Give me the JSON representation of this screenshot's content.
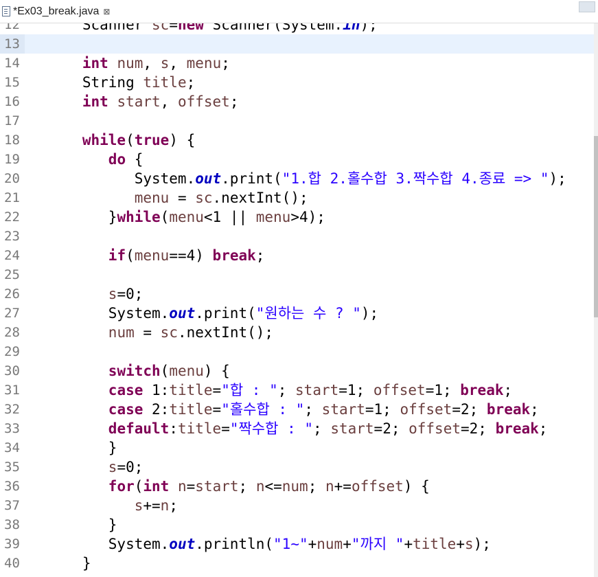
{
  "tab": {
    "title": "*Ex03_break.java",
    "close_symbol": "⊠"
  },
  "colors": {
    "keyword": "#7f0055",
    "string": "#2a00ff",
    "field": "#0000c0",
    "local_var": "#6a3e3e",
    "current_line": "#e8f2fe"
  },
  "editor": {
    "current_line": "13",
    "lines": [
      {
        "n": "12",
        "tokens": [
          [
            "p",
            "      Scanner "
          ],
          [
            "v",
            "sc"
          ],
          [
            "p",
            "="
          ],
          [
            "k",
            "new"
          ],
          [
            "p",
            " Scanner(System."
          ],
          [
            "f",
            "in"
          ],
          [
            "p",
            ");"
          ]
        ]
      },
      {
        "n": "13",
        "tokens": []
      },
      {
        "n": "14",
        "tokens": [
          [
            "p",
            "      "
          ],
          [
            "k",
            "int"
          ],
          [
            "p",
            " "
          ],
          [
            "v",
            "num"
          ],
          [
            "p",
            ", "
          ],
          [
            "v",
            "s"
          ],
          [
            "p",
            ", "
          ],
          [
            "v",
            "menu"
          ],
          [
            "p",
            ";"
          ]
        ]
      },
      {
        "n": "15",
        "tokens": [
          [
            "p",
            "      String "
          ],
          [
            "v",
            "title"
          ],
          [
            "p",
            ";"
          ]
        ]
      },
      {
        "n": "16",
        "tokens": [
          [
            "p",
            "      "
          ],
          [
            "k",
            "int"
          ],
          [
            "p",
            " "
          ],
          [
            "v",
            "start"
          ],
          [
            "p",
            ", "
          ],
          [
            "v",
            "offset"
          ],
          [
            "p",
            ";"
          ]
        ]
      },
      {
        "n": "17",
        "tokens": []
      },
      {
        "n": "18",
        "tokens": [
          [
            "p",
            "      "
          ],
          [
            "k",
            "while"
          ],
          [
            "p",
            "("
          ],
          [
            "k",
            "true"
          ],
          [
            "p",
            ") {"
          ]
        ]
      },
      {
        "n": "19",
        "tokens": [
          [
            "p",
            "         "
          ],
          [
            "k",
            "do"
          ],
          [
            "p",
            " {"
          ]
        ]
      },
      {
        "n": "20",
        "tokens": [
          [
            "p",
            "            System."
          ],
          [
            "f",
            "out"
          ],
          [
            "p",
            ".print("
          ],
          [
            "s",
            "\"1.합 2.홀수합 3.짝수합 4.종료 => \""
          ],
          [
            "p",
            ");"
          ]
        ]
      },
      {
        "n": "21",
        "tokens": [
          [
            "p",
            "            "
          ],
          [
            "v",
            "menu"
          ],
          [
            "p",
            " = "
          ],
          [
            "v",
            "sc"
          ],
          [
            "p",
            ".nextInt();"
          ]
        ]
      },
      {
        "n": "22",
        "tokens": [
          [
            "p",
            "         }"
          ],
          [
            "k",
            "while"
          ],
          [
            "p",
            "("
          ],
          [
            "v",
            "menu"
          ],
          [
            "p",
            "<1 || "
          ],
          [
            "v",
            "menu"
          ],
          [
            "p",
            ">4);"
          ]
        ]
      },
      {
        "n": "23",
        "tokens": []
      },
      {
        "n": "24",
        "tokens": [
          [
            "p",
            "         "
          ],
          [
            "k",
            "if"
          ],
          [
            "p",
            "("
          ],
          [
            "v",
            "menu"
          ],
          [
            "p",
            "==4) "
          ],
          [
            "k",
            "break"
          ],
          [
            "p",
            ";"
          ]
        ]
      },
      {
        "n": "25",
        "tokens": []
      },
      {
        "n": "26",
        "tokens": [
          [
            "p",
            "         "
          ],
          [
            "v",
            "s"
          ],
          [
            "p",
            "=0;"
          ]
        ]
      },
      {
        "n": "27",
        "tokens": [
          [
            "p",
            "         System."
          ],
          [
            "f",
            "out"
          ],
          [
            "p",
            ".print("
          ],
          [
            "s",
            "\"원하는 수 ? \""
          ],
          [
            "p",
            ");"
          ]
        ]
      },
      {
        "n": "28",
        "tokens": [
          [
            "p",
            "         "
          ],
          [
            "v",
            "num"
          ],
          [
            "p",
            " = "
          ],
          [
            "v",
            "sc"
          ],
          [
            "p",
            ".nextInt();"
          ]
        ]
      },
      {
        "n": "29",
        "tokens": []
      },
      {
        "n": "30",
        "tokens": [
          [
            "p",
            "         "
          ],
          [
            "k",
            "switch"
          ],
          [
            "p",
            "("
          ],
          [
            "v",
            "menu"
          ],
          [
            "p",
            ") {"
          ]
        ]
      },
      {
        "n": "31",
        "tokens": [
          [
            "p",
            "         "
          ],
          [
            "k",
            "case"
          ],
          [
            "p",
            " 1:"
          ],
          [
            "v",
            "title"
          ],
          [
            "p",
            "="
          ],
          [
            "s",
            "\"합 : \""
          ],
          [
            "p",
            "; "
          ],
          [
            "v",
            "start"
          ],
          [
            "p",
            "=1; "
          ],
          [
            "v",
            "offset"
          ],
          [
            "p",
            "=1; "
          ],
          [
            "k",
            "break"
          ],
          [
            "p",
            ";"
          ]
        ]
      },
      {
        "n": "32",
        "tokens": [
          [
            "p",
            "         "
          ],
          [
            "k",
            "case"
          ],
          [
            "p",
            " 2:"
          ],
          [
            "v",
            "title"
          ],
          [
            "p",
            "="
          ],
          [
            "s",
            "\"홀수합 : \""
          ],
          [
            "p",
            "; "
          ],
          [
            "v",
            "start"
          ],
          [
            "p",
            "=1; "
          ],
          [
            "v",
            "offset"
          ],
          [
            "p",
            "=2; "
          ],
          [
            "k",
            "break"
          ],
          [
            "p",
            ";"
          ]
        ]
      },
      {
        "n": "33",
        "tokens": [
          [
            "p",
            "         "
          ],
          [
            "k",
            "default"
          ],
          [
            "p",
            ":"
          ],
          [
            "v",
            "title"
          ],
          [
            "p",
            "="
          ],
          [
            "s",
            "\"짝수합 : \""
          ],
          [
            "p",
            "; "
          ],
          [
            "v",
            "start"
          ],
          [
            "p",
            "=2; "
          ],
          [
            "v",
            "offset"
          ],
          [
            "p",
            "=2; "
          ],
          [
            "k",
            "break"
          ],
          [
            "p",
            ";"
          ]
        ]
      },
      {
        "n": "34",
        "tokens": [
          [
            "p",
            "         }"
          ]
        ]
      },
      {
        "n": "35",
        "tokens": [
          [
            "p",
            "         "
          ],
          [
            "v",
            "s"
          ],
          [
            "p",
            "=0;"
          ]
        ]
      },
      {
        "n": "36",
        "tokens": [
          [
            "p",
            "         "
          ],
          [
            "k",
            "for"
          ],
          [
            "p",
            "("
          ],
          [
            "k",
            "int"
          ],
          [
            "p",
            " "
          ],
          [
            "v",
            "n"
          ],
          [
            "p",
            "="
          ],
          [
            "v",
            "start"
          ],
          [
            "p",
            "; "
          ],
          [
            "v",
            "n"
          ],
          [
            "p",
            "<="
          ],
          [
            "v",
            "num"
          ],
          [
            "p",
            "; "
          ],
          [
            "v",
            "n"
          ],
          [
            "p",
            "+="
          ],
          [
            "v",
            "offset"
          ],
          [
            "p",
            ") {"
          ]
        ]
      },
      {
        "n": "37",
        "tokens": [
          [
            "p",
            "            "
          ],
          [
            "v",
            "s"
          ],
          [
            "p",
            "+="
          ],
          [
            "v",
            "n"
          ],
          [
            "p",
            ";"
          ]
        ]
      },
      {
        "n": "38",
        "tokens": [
          [
            "p",
            "         }"
          ]
        ]
      },
      {
        "n": "39",
        "tokens": [
          [
            "p",
            "         System."
          ],
          [
            "f",
            "out"
          ],
          [
            "p",
            ".println("
          ],
          [
            "s",
            "\"1~\""
          ],
          [
            "p",
            "+"
          ],
          [
            "v",
            "num"
          ],
          [
            "p",
            "+"
          ],
          [
            "s",
            "\"까지 \""
          ],
          [
            "p",
            "+"
          ],
          [
            "v",
            "title"
          ],
          [
            "p",
            "+"
          ],
          [
            "v",
            "s"
          ],
          [
            "p",
            ");"
          ]
        ]
      },
      {
        "n": "40",
        "tokens": [
          [
            "p",
            "      }"
          ]
        ]
      }
    ]
  }
}
